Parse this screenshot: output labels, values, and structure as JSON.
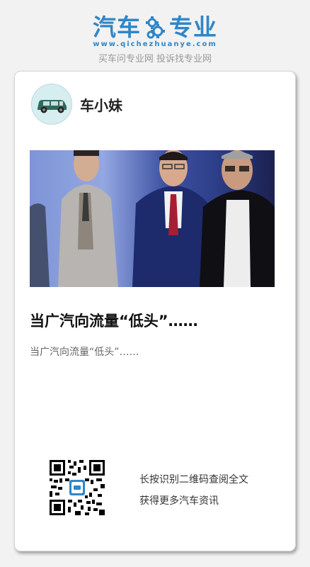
{
  "header": {
    "logo_left": "汽车",
    "logo_right": "专业",
    "url": "www.qichezhuanye.com",
    "slogan": "买车问专业网 投诉找专业网",
    "brand_color": "#2f86c8"
  },
  "card": {
    "author_name": "车小妹",
    "avatar_icon": "car-icon",
    "article_title": "当广汽向流量“低头”……",
    "article_summary": "当广汽向流量“低头”……",
    "qr_icon": "qr-code-icon",
    "qr_caption_1": "长按识别二维码查阅全文",
    "qr_caption_2": "获得更多汽车资讯"
  }
}
